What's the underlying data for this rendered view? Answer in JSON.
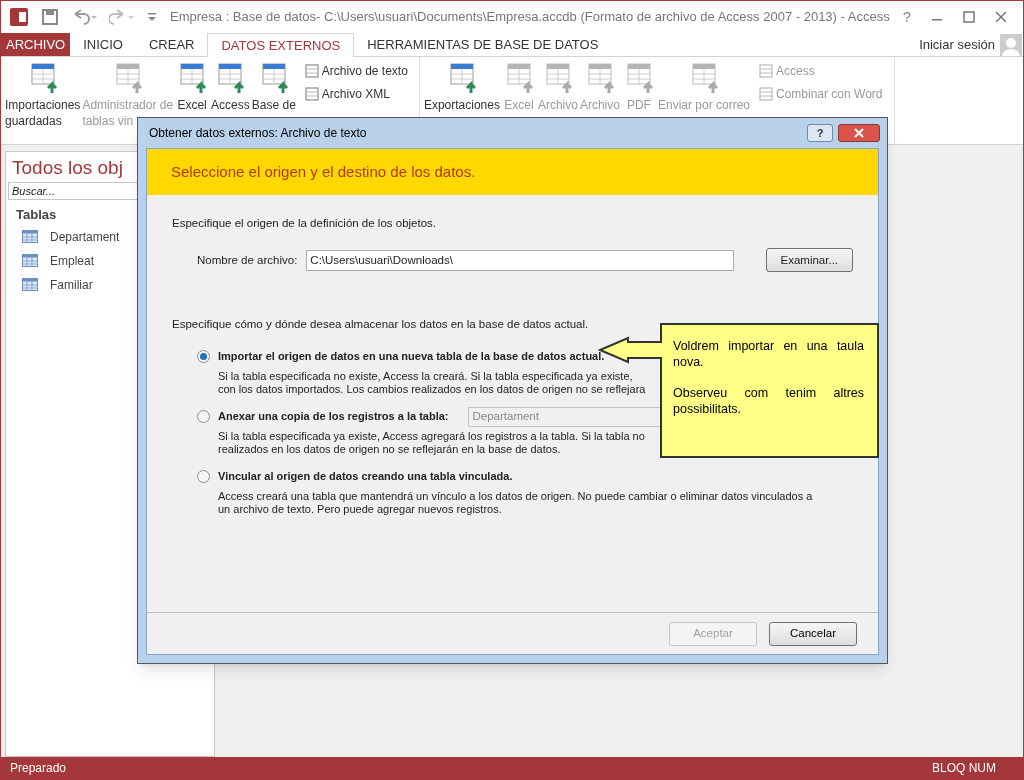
{
  "window": {
    "title": "Empresa : Base de datos- C:\\Users\\usuari\\Documents\\Empresa.accdb (Formato de archivo de Access 2007 - 2013) - Access",
    "help": "?"
  },
  "file_tab": "ARCHIVO",
  "tabs": [
    {
      "label": "INICIO",
      "selected": false
    },
    {
      "label": "CREAR",
      "selected": false
    },
    {
      "label": "DATOS EXTERNOS",
      "selected": true
    },
    {
      "label": "HERRAMIENTAS DE BASE DE DATOS",
      "selected": false
    }
  ],
  "user": "Iniciar sesión",
  "ribbon": {
    "groups": [
      {
        "large": [
          {
            "label": "Importaciones\nguardadas",
            "disabled": false
          },
          {
            "label": "Administrador de\ntablas vin",
            "disabled": true
          },
          {
            "label": "Excel",
            "disabled": false
          },
          {
            "label": "Access",
            "disabled": false
          },
          {
            "label": "Base de",
            "disabled": false
          }
        ],
        "small": [
          {
            "label": "Archivo de texto",
            "disabled": false
          },
          {
            "label": "Archivo XML",
            "disabled": false
          }
        ]
      },
      {
        "large": [
          {
            "label": "Exportaciones",
            "disabled": false
          },
          {
            "label": "Excel",
            "disabled": true
          },
          {
            "label": "Archivo",
            "disabled": true
          },
          {
            "label": "Archivo",
            "disabled": true
          },
          {
            "label": "PDF",
            "disabled": true
          },
          {
            "label": "Enviar por correo",
            "disabled": true
          }
        ],
        "small": [
          {
            "label": "Access",
            "disabled": true
          },
          {
            "label": "Combinar con Word",
            "disabled": true
          }
        ]
      }
    ]
  },
  "nav": {
    "title": "Todos los obj",
    "search": {
      "placeholder": "Buscar..."
    },
    "section": "Tablas",
    "items": [
      {
        "label": "Departament"
      },
      {
        "label": "Empleat"
      },
      {
        "label": "Familiar"
      }
    ]
  },
  "dialog": {
    "title": "Obtener datos externos: Archivo de texto",
    "help": "?",
    "header": "Seleccione el origen y el destino de los datos.",
    "intro": "Especifique el origen de la definición de los objetos.",
    "file_label": "Nombre de archivo:",
    "file_value": "C:\\Users\\usuari\\Downloads\\",
    "browse": "Examinar...",
    "store_intro": "Especifique cómo y dónde desea almacenar los datos en la base de datos actual.",
    "options": [
      {
        "label": "Importar el origen de datos en una nueva tabla de la base de datos actual.",
        "selected": true,
        "lines": [
          "Si la tabla especificada no existe, Access la creará. Si la tabla especificada ya existe,",
          "con los datos importados. Los cambios realizados en los datos de origen no se reflejara"
        ]
      },
      {
        "label": "Anexar una copia de los registros a la tabla:",
        "selected": false,
        "combo": {
          "value": "Departament",
          "disabled": true
        },
        "lines": [
          "Si la tabla especificada ya existe, Access agregará los registros a la tabla. Si la tabla no",
          "realizados en los datos de origen no se reflejarán en la base de datos."
        ]
      },
      {
        "label": "Vincular al origen de datos creando una tabla vinculada.",
        "selected": false,
        "lines": [
          "Access creará una tabla que mantendrá un vínculo a los datos de origen. No puede cambiar o eliminar datos vinculados a",
          "un archivo de texto. Pero puede agregar nuevos registros."
        ]
      }
    ],
    "buttons": [
      {
        "label": "Aceptar",
        "disabled": true
      },
      {
        "label": "Cancelar",
        "disabled": false
      }
    ]
  },
  "callout": {
    "paragraphs": [
      "Voldrem importar en una taula nova.",
      "Observeu com tenim altres possibilitats."
    ]
  },
  "status_bar": {
    "left": "Preparado",
    "right": "BLOQ NUM"
  }
}
